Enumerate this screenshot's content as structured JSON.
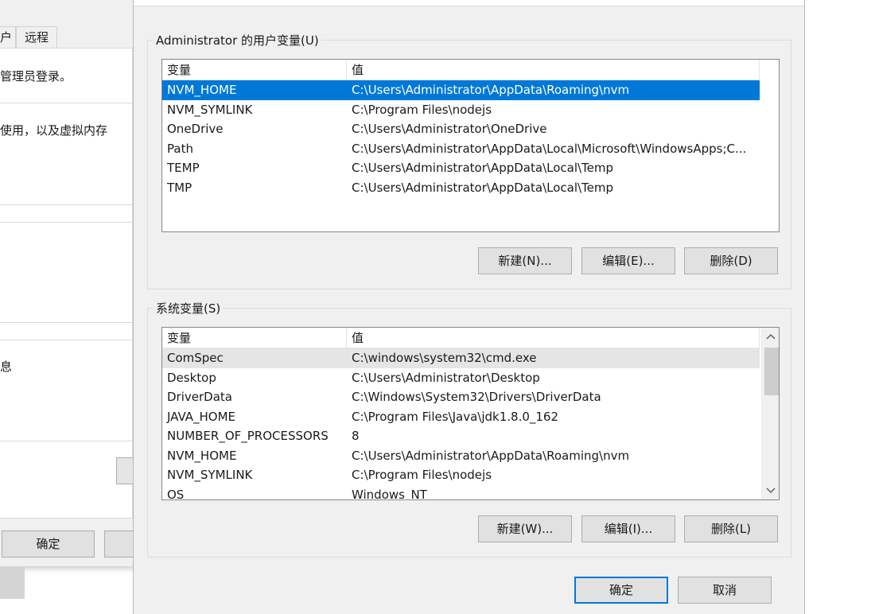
{
  "background_dialog": {
    "tabs": [
      "户",
      "远程"
    ],
    "lines": [
      "管理员登录。",
      "使用，以及虚拟内存",
      "息"
    ],
    "ok_label": "确定"
  },
  "user_vars": {
    "title": "Administrator 的用户变量(U)",
    "col_name": "变量",
    "col_value": "值",
    "rows": [
      {
        "name": "NVM_HOME",
        "value": "C:\\Users\\Administrator\\AppData\\Roaming\\nvm"
      },
      {
        "name": "NVM_SYMLINK",
        "value": "C:\\Program Files\\nodejs"
      },
      {
        "name": "OneDrive",
        "value": "C:\\Users\\Administrator\\OneDrive"
      },
      {
        "name": "Path",
        "value": "C:\\Users\\Administrator\\AppData\\Local\\Microsoft\\WindowsApps;C..."
      },
      {
        "name": "TEMP",
        "value": "C:\\Users\\Administrator\\AppData\\Local\\Temp"
      },
      {
        "name": "TMP",
        "value": "C:\\Users\\Administrator\\AppData\\Local\\Temp"
      }
    ],
    "new_label": "新建(N)...",
    "edit_label": "编辑(E)...",
    "delete_label": "删除(D)"
  },
  "sys_vars": {
    "title": "系统变量(S)",
    "col_name": "变量",
    "col_value": "值",
    "rows": [
      {
        "name": "ComSpec",
        "value": "C:\\windows\\system32\\cmd.exe"
      },
      {
        "name": "Desktop",
        "value": "C:\\Users\\Administrator\\Desktop"
      },
      {
        "name": "DriverData",
        "value": "C:\\Windows\\System32\\Drivers\\DriverData"
      },
      {
        "name": "JAVA_HOME",
        "value": "C:\\Program Files\\Java\\jdk1.8.0_162"
      },
      {
        "name": "NUMBER_OF_PROCESSORS",
        "value": "8"
      },
      {
        "name": "NVM_HOME",
        "value": "C:\\Users\\Administrator\\AppData\\Roaming\\nvm"
      },
      {
        "name": "NVM_SYMLINK",
        "value": "C:\\Program Files\\nodejs"
      },
      {
        "name": "OS",
        "value": "Windows_NT"
      }
    ],
    "new_label": "新建(W)...",
    "edit_label": "编辑(I)...",
    "delete_label": "删除(L)"
  },
  "footer": {
    "ok_label": "确定",
    "cancel_label": "取消"
  },
  "icons": {
    "scroll_up": "chevron-up-icon",
    "scroll_down": "chevron-down-icon"
  },
  "colors": {
    "selection": "#0078d7",
    "dialog_bg": "#f0f0f0"
  }
}
